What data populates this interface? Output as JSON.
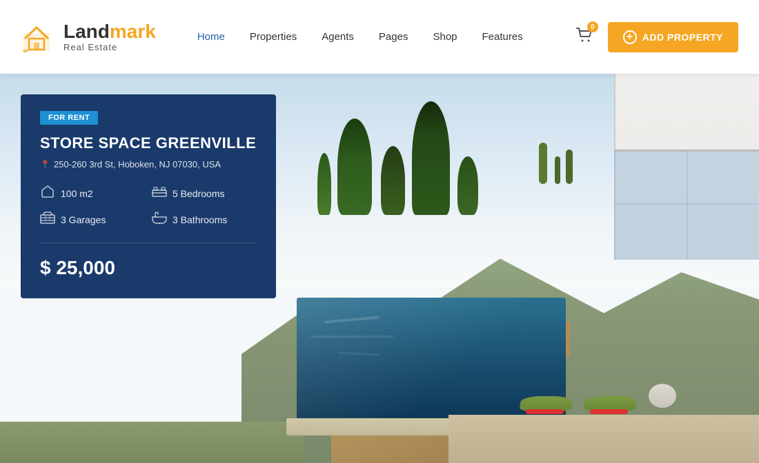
{
  "header": {
    "logo": {
      "land": "Land",
      "mark": "mark",
      "subtitle": "Real Estate"
    },
    "nav": {
      "items": [
        {
          "label": "Home",
          "active": true
        },
        {
          "label": "Properties",
          "active": false
        },
        {
          "label": "Agents",
          "active": false
        },
        {
          "label": "Pages",
          "active": false
        },
        {
          "label": "Shop",
          "active": false
        },
        {
          "label": "Features",
          "active": false
        }
      ]
    },
    "cart": {
      "badge": "0"
    },
    "add_property_btn": "ADD PROPERTY"
  },
  "property": {
    "badge": "FOR RENT",
    "title": "STORE SPACE GREENVILLE",
    "address": "250-260 3rd St, Hoboken, NJ 07030, USA",
    "features": {
      "area": "100 m2",
      "bedrooms": "5 Bedrooms",
      "garages": "3 Garages",
      "bathrooms": "3 Bathrooms"
    },
    "price": "$ 25,000"
  },
  "colors": {
    "accent_orange": "#f5a623",
    "nav_active": "#2563a8",
    "card_bg": "#1a3a6b",
    "badge_blue": "#1e90d4"
  }
}
